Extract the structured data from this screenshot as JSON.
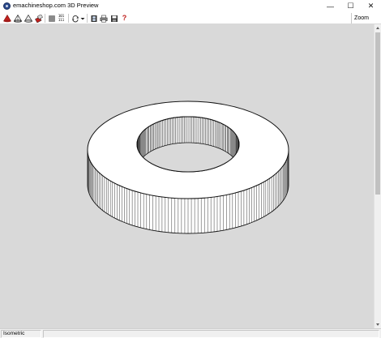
{
  "window": {
    "title": "emachineshop.com 3D Preview",
    "minimize_label": "—",
    "maximize_label": "☐",
    "close_label": "✕"
  },
  "toolbar": {
    "buttons": [
      {
        "name": "red-solid-view-button",
        "icon": "red-cone-icon",
        "color": "#c0201d"
      },
      {
        "name": "wireframe-view-button",
        "icon": "wireframe-cone-icon"
      },
      {
        "name": "shaded-view-button",
        "icon": "shaded-cone-icon"
      },
      {
        "name": "render-view-button",
        "icon": "paint-icon"
      },
      {
        "name": "stop-button",
        "icon": "gray-square-icon"
      },
      {
        "name": "numbers-button",
        "icon": "digits-icon",
        "text_top": "101",
        "text_bottom": "111"
      },
      {
        "name": "rotate-button",
        "icon": "rotate-arrows-icon"
      },
      {
        "name": "rotate-dropdown-button",
        "icon": "dropdown-arrow-icon"
      },
      {
        "name": "film-button",
        "icon": "filmstrip-icon"
      },
      {
        "name": "print-button",
        "icon": "printer-icon"
      },
      {
        "name": "save-button",
        "icon": "floppy-disk-icon"
      },
      {
        "name": "help-button",
        "icon": "question-mark-icon",
        "text": "?",
        "color": "#c0201d"
      }
    ],
    "zoom_label": "Zoom"
  },
  "viewport": {
    "background": "#d9d9d9"
  },
  "statusbar": {
    "view_label": "Isometric",
    "info": ""
  }
}
